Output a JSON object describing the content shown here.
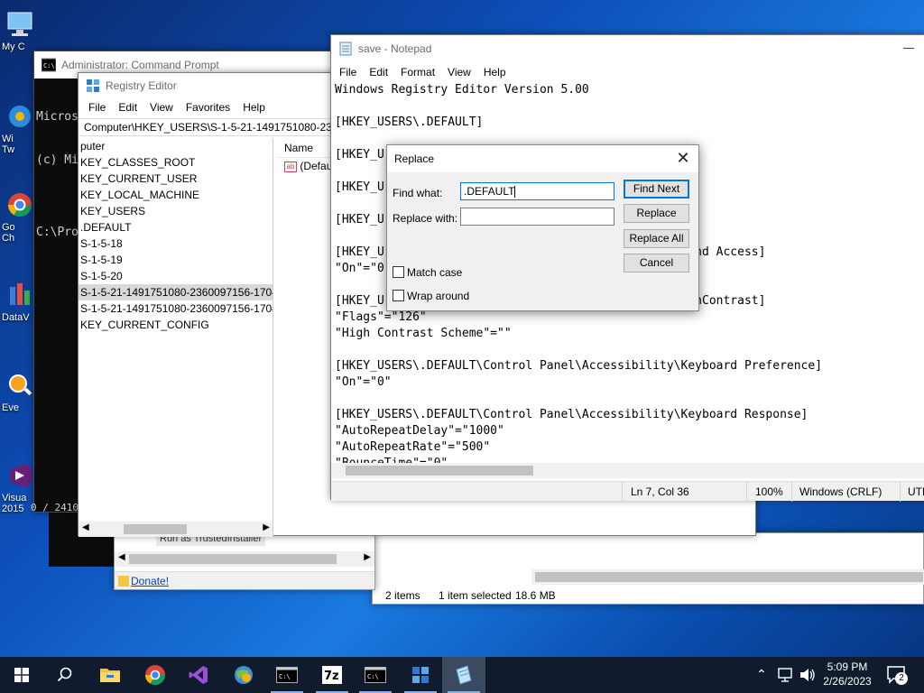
{
  "desktop": {
    "icons": [
      {
        "label": "My C",
        "name": "this-pc"
      },
      {
        "label": "Wi",
        "label2": "Tw",
        "name": "windows-tweaker"
      },
      {
        "label": "Go",
        "label2": "Ch",
        "name": "google-chrome"
      },
      {
        "label": "DataV",
        "name": "dataviewer"
      },
      {
        "label": "Eve",
        "name": "everything"
      },
      {
        "label": "Visua",
        "label2": "2015",
        "name": "visual-studio"
      }
    ]
  },
  "cmd": {
    "title": "Administrator: Command Prompt",
    "lines": [
      "Micros",
      "(c) Mi",
      "",
      "C:\\Pro"
    ],
    "footer": "0 / 2410 0"
  },
  "regedit": {
    "title": "Registry Editor",
    "menu": [
      "File",
      "Edit",
      "View",
      "Favorites",
      "Help"
    ],
    "address": "Computer\\HKEY_USERS\\S-1-5-21-1491751080-23600",
    "tree": [
      {
        "label": "puter",
        "selected": false
      },
      {
        "label": "KEY_CLASSES_ROOT",
        "selected": false
      },
      {
        "label": "KEY_CURRENT_USER",
        "selected": false
      },
      {
        "label": "KEY_LOCAL_MACHINE",
        "selected": false
      },
      {
        "label": "KEY_USERS",
        "selected": false
      },
      {
        "label": ".DEFAULT",
        "selected": false
      },
      {
        "label": "S-1-5-18",
        "selected": false
      },
      {
        "label": "S-1-5-19",
        "selected": false
      },
      {
        "label": "S-1-5-20",
        "selected": false
      },
      {
        "label": "S-1-5-21-1491751080-2360097156-17042",
        "selected": true
      },
      {
        "label": "S-1-5-21-1491751080-2360097156-17042",
        "selected": false
      },
      {
        "label": "KEY_CURRENT_CONFIG",
        "selected": false
      }
    ],
    "list_header": "Name",
    "list_rows": [
      "(Defau"
    ]
  },
  "explorer": {
    "context_item": "Run as TrustedInstaller",
    "donate_link": "Donate!",
    "status": {
      "items": "2 items",
      "selected": "1 item selected",
      "size": "18.6 MB"
    }
  },
  "notepad": {
    "title": "save - Notepad",
    "menu": [
      "File",
      "Edit",
      "Format",
      "View",
      "Help"
    ],
    "lines": [
      "Windows Registry Editor Version 5.00",
      "",
      "[HKEY_USERS\\.DEFAULT]",
      "",
      "[HKEY_U",
      "",
      "[HKEY_U",
      "",
      "[HKEY_U",
      "",
      "[HKEY_U                                          lind Access]",
      "\"On\"=\"0",
      "",
      "[HKEY_U                                          ighContrast]",
      "\"Flags\"=\"126\"",
      "\"High Contrast Scheme\"=\"\"",
      "",
      "[HKEY_USERS\\.DEFAULT\\Control Panel\\Accessibility\\Keyboard Preference]",
      "\"On\"=\"0\"",
      "",
      "[HKEY_USERS\\.DEFAULT\\Control Panel\\Accessibility\\Keyboard Response]",
      "\"AutoRepeatDelay\"=\"1000\"",
      "\"AutoRepeatRate\"=\"500\"",
      "\"BounceTime\"=\"0\""
    ],
    "status": {
      "position": "Ln 7, Col 36",
      "zoom": "100%",
      "eol": "Windows (CRLF)",
      "encoding": "UTF"
    }
  },
  "replace_dialog": {
    "title": "Replace",
    "find_label": "Find what:",
    "find_value": ".DEFAULT",
    "replace_label": "Replace with:",
    "replace_value": "",
    "find_next": "Find Next",
    "replace": "Replace",
    "replace_all": "Replace All",
    "cancel": "Cancel",
    "match_case": "Match case",
    "wrap_around": "Wrap around"
  },
  "taskbar": {
    "time": "5:09 PM",
    "date": "2/26/2023",
    "notification_count": "2"
  }
}
